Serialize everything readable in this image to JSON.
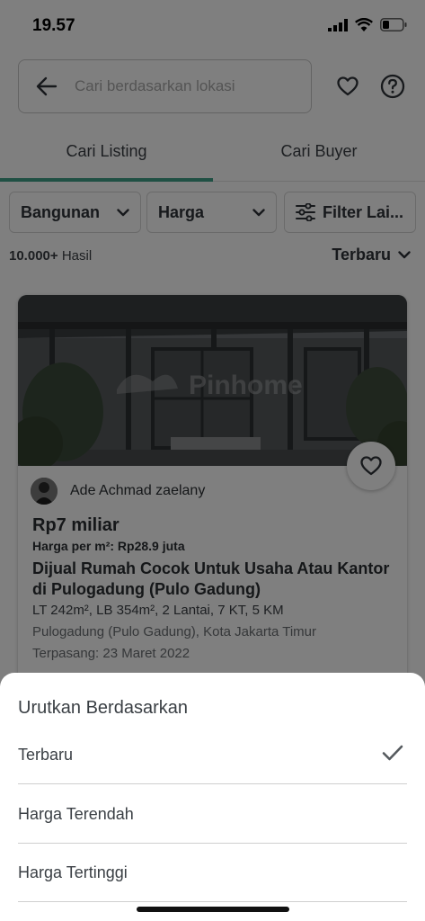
{
  "status_bar": {
    "time": "19.57",
    "signal_icon": "cellular-signal-icon",
    "wifi_icon": "wifi-icon",
    "battery_icon": "battery-low-icon"
  },
  "search": {
    "placeholder": "Cari berdasarkan lokasi",
    "back_icon": "arrow-left-icon",
    "favorites_icon": "heart-outline-icon",
    "help_icon": "question-circle-icon"
  },
  "tabs": [
    {
      "label": "Cari Listing",
      "active": true
    },
    {
      "label": "Cari Buyer",
      "active": false
    }
  ],
  "accent_color": "#41a089",
  "filters": {
    "type_label": "Bangunan",
    "price_label": "Harga",
    "more_label": "Filter Lai...",
    "more_icon": "sliders-icon",
    "chevron_icon": "chevron-down-icon"
  },
  "results": {
    "count_bold": "10.000+",
    "count_suffix": "Hasil",
    "sort_label": "Terbaru"
  },
  "listing": {
    "watermark": "Pinhome",
    "agent_name": "Ade Achmad zaelany",
    "price": "Rp7 miliar",
    "price_per_m2": "Harga per m²: Rp28.9 juta",
    "title": "Dijual Rumah Cocok Untuk Usaha Atau Kantor di Pulogadung (Pulo Gadung)",
    "specs": "LT 242m², LB 354m², 2 Lantai, 7 KT, 5 KM",
    "location": "Pulogadung (Pulo Gadung), Kota Jakarta Timur",
    "posted": "Terpasang: 23 Maret 2022"
  },
  "sort_sheet": {
    "title": "Urutkan Berdasarkan",
    "options": [
      {
        "label": "Terbaru",
        "selected": true
      },
      {
        "label": "Harga Terendah",
        "selected": false
      },
      {
        "label": "Harga Tertinggi",
        "selected": false
      }
    ],
    "check_icon": "checkmark-icon"
  }
}
